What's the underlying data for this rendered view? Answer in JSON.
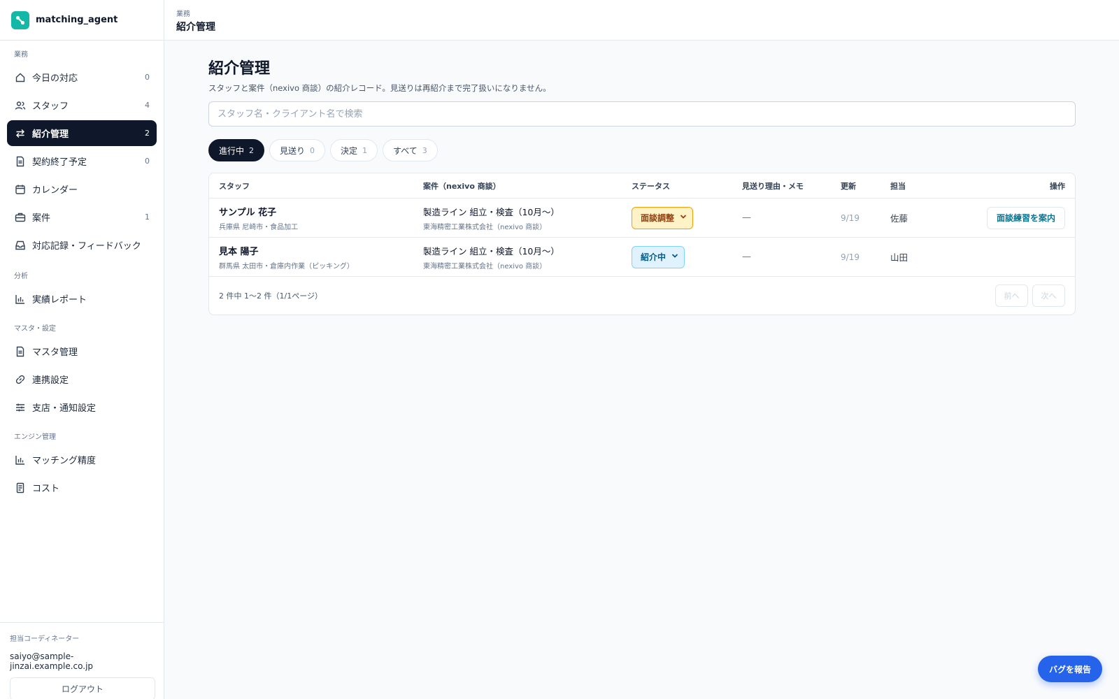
{
  "app": {
    "name": "matching_agent"
  },
  "sidebar": {
    "sections": [
      {
        "title": "業務"
      },
      {
        "title": "分析"
      },
      {
        "title": "マスタ・設定"
      },
      {
        "title": "エンジン管理"
      }
    ],
    "items": [
      {
        "label": "今日の対応",
        "count": "0",
        "icon": "home-icon"
      },
      {
        "label": "スタッフ",
        "count": "4",
        "icon": "users-icon"
      },
      {
        "label": "紹介管理",
        "count": "2",
        "icon": "swap-arrows-icon",
        "active": true
      },
      {
        "label": "契約終了予定",
        "count": "0",
        "icon": "document-icon"
      },
      {
        "label": "カレンダー",
        "count": "",
        "icon": "calendar-icon"
      },
      {
        "label": "案件",
        "count": "1",
        "icon": "briefcase-icon"
      },
      {
        "label": "対応記録・フィードバック",
        "count": "",
        "icon": "inbox-icon"
      },
      {
        "label": "実績レポート",
        "count": "",
        "icon": "bar-chart-icon"
      },
      {
        "label": "マスタ管理",
        "count": "",
        "icon": "document-icon"
      },
      {
        "label": "連携設定",
        "count": "",
        "icon": "link-icon"
      },
      {
        "label": "支店・通知設定",
        "count": "",
        "icon": "sliders-icon"
      },
      {
        "label": "マッチング精度",
        "count": "",
        "icon": "bar-chart-icon"
      },
      {
        "label": "コスト",
        "count": "",
        "icon": "receipt-icon"
      }
    ],
    "footer": {
      "label": "担当コーディネーター",
      "email": "saiyo@sample-jinzai.example.co.jp",
      "logout": "ログアウト"
    }
  },
  "topbar": {
    "section": "業務",
    "title": "紹介管理"
  },
  "main": {
    "title": "紹介管理",
    "subtitle": "スタッフと案件（nexivo 商談）の紹介レコード。見送りは再紹介まで完了扱いになりません。",
    "search_placeholder": "スタッフ名・クライアント名で検索",
    "filters": [
      {
        "label": "進行中",
        "count": "2",
        "active": true
      },
      {
        "label": "見送り",
        "count": "0"
      },
      {
        "label": "決定",
        "count": "1"
      },
      {
        "label": "すべて",
        "count": "3"
      }
    ],
    "table": {
      "columns": [
        "スタッフ",
        "案件（nexivo 商談）",
        "ステータス",
        "見送り理由・メモ",
        "更新",
        "担当",
        "操作"
      ],
      "rows": [
        {
          "staff": "サンプル 花子",
          "staff_sub": "兵庫県 尼崎市・食品加工",
          "case": "製造ライン 組立・検査（10月〜）",
          "case_sub": "東海精密工業株式会社（nexivo 商談）",
          "status": "面談調整",
          "memo": "—",
          "updated": "9/19",
          "owner": "佐藤",
          "action": "面談練習を案内"
        },
        {
          "staff": "見本 陽子",
          "staff_sub": "群馬県 太田市・倉庫内作業（ピッキング）",
          "case": "製造ライン 組立・検査（10月〜）",
          "case_sub": "東海精密工業株式会社（nexivo 商談）",
          "status": "紹介中",
          "memo": "—",
          "updated": "9/19",
          "owner": "山田",
          "action": ""
        }
      ],
      "pagination": {
        "info": "2 件中 1〜2 件（1/1ページ）",
        "prev": "前へ",
        "next": "次へ"
      }
    }
  },
  "bug_report": "バグを報告",
  "colors": {
    "active_nav": "#0f172a",
    "brand": "#14b8a6",
    "accent": "#2563eb",
    "status_amber": "#fef3c7",
    "status_blue": "#e0f2fe"
  }
}
